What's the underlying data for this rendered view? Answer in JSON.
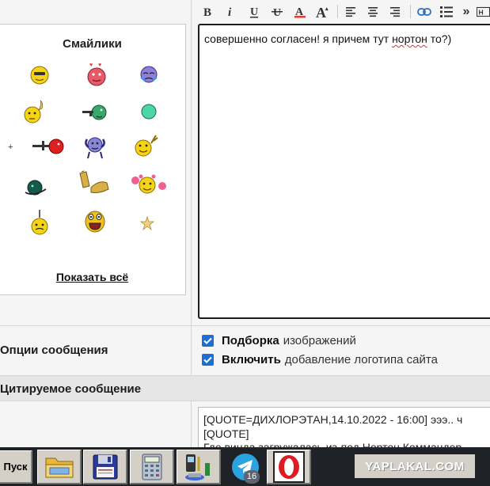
{
  "toolbar": {
    "buttons": [
      {
        "name": "bold-button",
        "icon": "bold-icon"
      },
      {
        "name": "italic-button",
        "icon": "italic-icon"
      },
      {
        "name": "underline-button",
        "icon": "underline-icon"
      },
      {
        "name": "strikethrough-button",
        "icon": "strikethrough-icon"
      },
      {
        "name": "font-color-button",
        "icon": "font-color-icon",
        "color": "#e53935"
      },
      {
        "name": "font-size-button",
        "icon": "font-size-icon"
      },
      {
        "name": "align-left-button",
        "icon": "align-left-icon"
      },
      {
        "name": "align-center-button",
        "icon": "align-center-icon"
      },
      {
        "name": "align-right-button",
        "icon": "align-right-icon"
      },
      {
        "name": "link-button",
        "icon": "link-icon"
      },
      {
        "name": "list-button",
        "icon": "list-icon"
      },
      {
        "name": "more-button",
        "icon": "double-chevron-right-icon",
        "label": "»"
      },
      {
        "name": "heading-button",
        "icon": "heading-icon"
      }
    ]
  },
  "smileys": {
    "title": "Смайлики",
    "show_all": "Показать всё"
  },
  "editor": {
    "text_before": "совершенно согласен!  я причем тут ",
    "text_misspelled": "нортон",
    "text_after": " то?)"
  },
  "options": {
    "label": "Опции сообщения",
    "checkboxes": [
      {
        "bold": "Подборка",
        "text": "изображений",
        "checked": true
      },
      {
        "bold": "Включить",
        "text": "добавление логотипа сайта",
        "checked": true
      }
    ]
  },
  "quoted": {
    "label": "Цитируемое сообщение",
    "lines": [
      "[QUOTE=ДИХЛОРЭТАН,14.10.2022 - 16:00] эээ.. ч",
      "[QUOTE]",
      "Где винда загружалась из-под Нортон Коммандер"
    ]
  },
  "taskbar": {
    "start_label": "Пуск",
    "apps": [
      {
        "name": "folder",
        "icon": "folder-icon"
      },
      {
        "name": "floppy",
        "icon": "floppy-icon"
      },
      {
        "name": "calculator",
        "icon": "calculator-icon"
      },
      {
        "name": "phone-tools",
        "icon": "phone-tools-icon"
      },
      {
        "name": "telegram",
        "icon": "telegram-icon"
      },
      {
        "name": "opera",
        "icon": "opera-icon"
      }
    ],
    "telegram_badge": "16",
    "brand": "YAPLAKAL.COM"
  },
  "colors": {
    "checkbox": "#1d6fd6",
    "editor_border": "#1c1c1c",
    "taskbar": "#1f2328",
    "win_button": "#d4d0c8"
  }
}
